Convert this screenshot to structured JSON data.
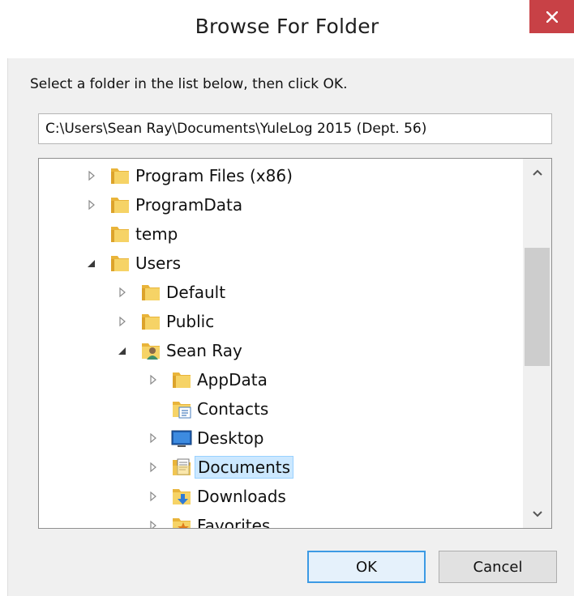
{
  "window": {
    "title": "Browse For Folder",
    "close_glyph": "✕"
  },
  "instruction": "Select a folder in the list below, then click OK.",
  "path_field": {
    "value": "C:\\Users\\Sean Ray\\Documents\\YuleLog 2015 (Dept. 56)"
  },
  "tree": {
    "items": [
      {
        "label": "Program Files (x86)",
        "depth": 0,
        "expander": "collapsed",
        "icon": "folder-icon"
      },
      {
        "label": "ProgramData",
        "depth": 0,
        "expander": "collapsed",
        "icon": "folder-icon"
      },
      {
        "label": "temp",
        "depth": 0,
        "expander": "none",
        "icon": "folder-icon"
      },
      {
        "label": "Users",
        "depth": 0,
        "expander": "expanded",
        "icon": "folder-icon"
      },
      {
        "label": "Default",
        "depth": 1,
        "expander": "collapsed",
        "icon": "folder-icon"
      },
      {
        "label": "Public",
        "depth": 1,
        "expander": "collapsed",
        "icon": "folder-icon"
      },
      {
        "label": "Sean Ray",
        "depth": 1,
        "expander": "expanded",
        "icon": "user-folder-icon"
      },
      {
        "label": "AppData",
        "depth": 2,
        "expander": "collapsed",
        "icon": "folder-icon"
      },
      {
        "label": "Contacts",
        "depth": 2,
        "expander": "none",
        "icon": "contacts-folder-icon"
      },
      {
        "label": "Desktop",
        "depth": 2,
        "expander": "collapsed",
        "icon": "desktop-icon"
      },
      {
        "label": "Documents",
        "depth": 2,
        "expander": "collapsed",
        "icon": "documents-folder-icon",
        "selected": true
      },
      {
        "label": "Downloads",
        "depth": 2,
        "expander": "collapsed",
        "icon": "downloads-folder-icon"
      },
      {
        "label": "Favorites",
        "depth": 2,
        "expander": "collapsed",
        "icon": "favorites-folder-icon"
      }
    ]
  },
  "buttons": {
    "ok": "OK",
    "cancel": "Cancel"
  },
  "colors": {
    "close_button": "#c84146",
    "selection_fill": "#cce8ff",
    "selection_border": "#99d1ff",
    "default_button_border": "#3c9ae4",
    "folder_yellow": "#f3c84b"
  }
}
